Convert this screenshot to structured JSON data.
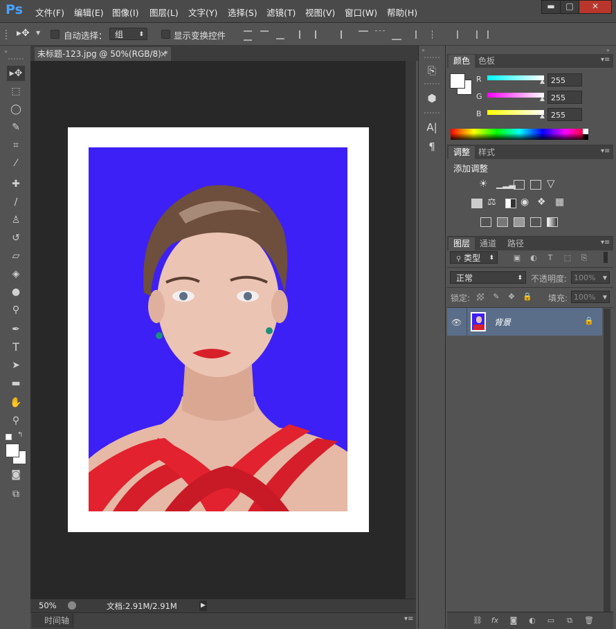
{
  "app": {
    "logo": "Ps"
  },
  "menu": [
    "文件(F)",
    "编辑(E)",
    "图像(I)",
    "图层(L)",
    "文字(Y)",
    "选择(S)",
    "滤镜(T)",
    "视图(V)",
    "窗口(W)",
    "帮助(H)"
  ],
  "window_controls": {
    "minimize": "▬",
    "maximize": "□",
    "close": "✕"
  },
  "options": {
    "auto_select_label": "自动选择：",
    "auto_select_value": "组",
    "show_transform_label": "显示变换控件"
  },
  "document": {
    "tab_title": "未标题-123.jpg @ 50%(RGB/8) *",
    "close_glyph": "×",
    "zoom": "50%",
    "doc_size": "文档:2.91M/2.91M"
  },
  "timeline": {
    "label": "时间轴"
  },
  "color_panel": {
    "tabs": [
      "颜色",
      "色板"
    ],
    "channels": [
      {
        "name": "R",
        "value": "255"
      },
      {
        "name": "G",
        "value": "255"
      },
      {
        "name": "B",
        "value": "255"
      }
    ]
  },
  "adjust_panel": {
    "tabs": [
      "调整",
      "样式"
    ],
    "heading": "添加调整"
  },
  "layers_panel": {
    "tabs": [
      "图层",
      "通道",
      "路径"
    ],
    "filter_kind": "类型",
    "blend_mode": "正常",
    "opacity_label": "不透明度:",
    "opacity_value": "100%",
    "lock_label": "锁定:",
    "fill_label": "填充:",
    "fill_value": "100%",
    "layers": [
      {
        "name": "背景",
        "visible": true,
        "locked": true
      }
    ]
  },
  "icons": [
    "move-tool-icon",
    "marquee-tool-icon",
    "lasso-tool-icon",
    "quick-select-icon",
    "crop-tool-icon",
    "eyedropper-icon",
    "healing-brush-icon",
    "brush-tool-icon",
    "clone-stamp-icon",
    "history-brush-icon",
    "eraser-icon",
    "paint-bucket-icon",
    "blur-tool-icon",
    "dodge-tool-icon",
    "pen-tool-icon",
    "type-tool-icon",
    "path-select-icon",
    "rectangle-tool-icon",
    "hand-tool-icon",
    "zoom-tool-icon",
    "quick-mask-icon",
    "screen-mode-icon"
  ],
  "colors": {
    "photo_background": "#3d20f5",
    "accent": "#4aa3ff"
  }
}
